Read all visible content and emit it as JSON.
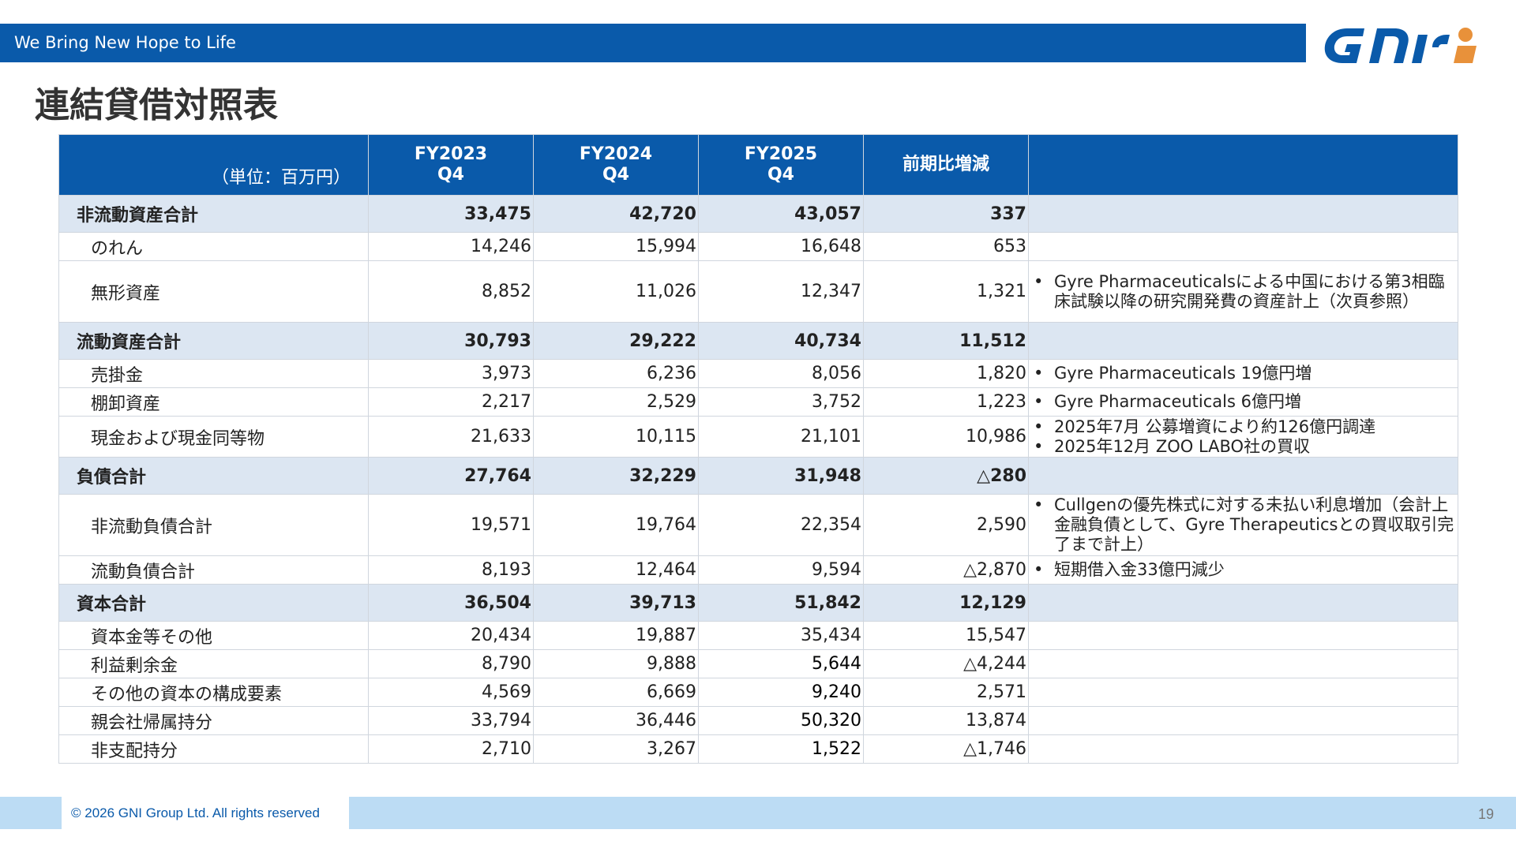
{
  "header": {
    "tagline": "We Bring New Hope to Life",
    "logo_text": "GNI",
    "colors": {
      "brand_blue": "#0a5aaa",
      "accent_orange": "#e8913a",
      "section_fill": "#dce6f2",
      "footer_fill": "#bcdcf4"
    }
  },
  "title": "連結貸借対照表",
  "table": {
    "columns": {
      "unit": "（単位：百万円）",
      "fy2023": [
        "FY2023",
        "Q4"
      ],
      "fy2024": [
        "FY2024",
        "Q4"
      ],
      "fy2025": [
        "FY2025",
        "Q4"
      ],
      "change": "前期比増減"
    },
    "rows": [
      {
        "type": "section",
        "label": "非流動資産合計",
        "values": [
          "33,475",
          "42,720",
          "43,057",
          "337"
        ],
        "notes": []
      },
      {
        "type": "item",
        "label": "のれん",
        "values": [
          "14,246",
          "15,994",
          "16,648",
          "653"
        ],
        "notes": []
      },
      {
        "type": "item",
        "label": "無形資産",
        "values": [
          "8,852",
          "11,026",
          "12,347",
          "1,321"
        ],
        "notes": [
          "Gyre Pharmaceuticalsによる中国における第3相臨床試験以降の研究開発費の資産計上（次頁参照）"
        ]
      },
      {
        "type": "section",
        "label": "流動資産合計",
        "values": [
          "30,793",
          "29,222",
          "40,734",
          "11,512"
        ],
        "notes": []
      },
      {
        "type": "item",
        "label": "売掛金",
        "values": [
          "3,973",
          "6,236",
          "8,056",
          "1,820"
        ],
        "notes": [
          "Gyre Pharmaceuticals 19億円増"
        ]
      },
      {
        "type": "item",
        "label": "棚卸資産",
        "values": [
          "2,217",
          "2,529",
          "3,752",
          "1,223"
        ],
        "notes": [
          "Gyre Pharmaceuticals 6億円増"
        ]
      },
      {
        "type": "item",
        "label": "現金および現金同等物",
        "values": [
          "21,633",
          "10,115",
          "21,101",
          "10,986"
        ],
        "notes": [
          "2025年7月 公募増資により約126億円調達",
          "2025年12月 ZOO LABO社の買収"
        ]
      },
      {
        "type": "section",
        "label": "負債合計",
        "values": [
          "27,764",
          "32,229",
          "31,948",
          "△280"
        ],
        "notes": []
      },
      {
        "type": "item",
        "label": "非流動負債合計",
        "values": [
          "19,571",
          "19,764",
          "22,354",
          "2,590"
        ],
        "notes": [
          "Cullgenの優先株式に対する未払い利息増加（会計上金融負債として、Gyre Therapeuticsとの買収取引完了まで計上）"
        ]
      },
      {
        "type": "item",
        "label": "流動負債合計",
        "values": [
          "8,193",
          "12,464",
          "9,594",
          "△2,870"
        ],
        "notes": [
          "短期借入金33億円減少"
        ]
      },
      {
        "type": "section",
        "label": "資本合計",
        "values": [
          "36,504",
          "39,713",
          "51,842",
          "12,129"
        ],
        "notes": []
      },
      {
        "type": "item",
        "label": "資本金等その他",
        "values": [
          "20,434",
          "19,887",
          "35,434",
          "15,547"
        ],
        "notes": []
      },
      {
        "type": "item",
        "label": "利益剰余金",
        "values": [
          "8,790",
          "9,888",
          "5,644",
          "△4,244"
        ],
        "notes": []
      },
      {
        "type": "item",
        "label": "その他の資本の構成要素",
        "values": [
          "4,569",
          "6,669",
          "9,240",
          "2,571"
        ],
        "notes": []
      },
      {
        "type": "item",
        "label": "親会社帰属持分",
        "values": [
          "33,794",
          "36,446",
          "50,320",
          "13,874"
        ],
        "notes": []
      },
      {
        "type": "item",
        "label": "非支配持分",
        "values": [
          "2,710",
          "3,267",
          "1,522",
          "△1,746"
        ],
        "notes": []
      }
    ]
  },
  "footer": {
    "copyright": "© 2026 GNI Group Ltd. All rights reserved",
    "page_number": "19"
  }
}
